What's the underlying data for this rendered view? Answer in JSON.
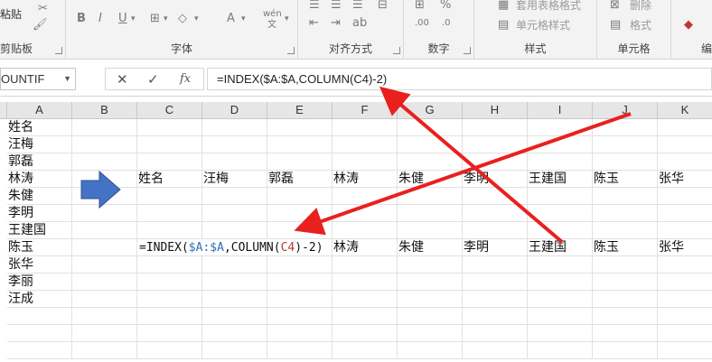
{
  "ribbon": {
    "clipboard": {
      "paste_label": "粘贴",
      "group_label": "剪贴板"
    },
    "font": {
      "group_label": "字体",
      "wen_label": "wén",
      "wen_sub": "文"
    },
    "alignment": {
      "group_label": "对齐方式"
    },
    "number": {
      "group_label": "数字"
    },
    "styles": {
      "group_label": "样式",
      "table_format_label": "套用表格格式",
      "cell_style_label": "单元格样式"
    },
    "cells": {
      "group_label": "单元格",
      "delete_label": "删除",
      "format_label": "格式"
    },
    "editing": {
      "group_label": "编"
    }
  },
  "formula_bar": {
    "name_box": "OUNTIF",
    "formula": "=INDEX($A:$A,COLUMN(C4)-2)"
  },
  "grid": {
    "columns": [
      "A",
      "B",
      "C",
      "D",
      "E",
      "F",
      "G",
      "H",
      "I",
      "J",
      "K"
    ],
    "column_a_values": [
      "姓名",
      "汪梅",
      "郭磊",
      "林涛",
      "朱健",
      "李明",
      "王建国",
      "陈玉",
      "张华",
      "李丽",
      "汪成"
    ],
    "row4_values": [
      "姓名",
      "汪梅",
      "郭磊",
      "林涛",
      "朱健",
      "李明",
      "王建国",
      "陈玉",
      "张华"
    ],
    "row8_values": [
      "林涛",
      "朱健",
      "李明",
      "王建国",
      "陈玉",
      "张华"
    ],
    "formula_in_cell": {
      "prefix": "=INDEX(",
      "ref_range": "$A:$A",
      "mid": ",COLUMN(",
      "ref_cell": "C4",
      "suffix": ")-2)"
    }
  },
  "annotations": {
    "arrow_color": "#e8211f",
    "block_arrow_color": "#4472c4"
  }
}
